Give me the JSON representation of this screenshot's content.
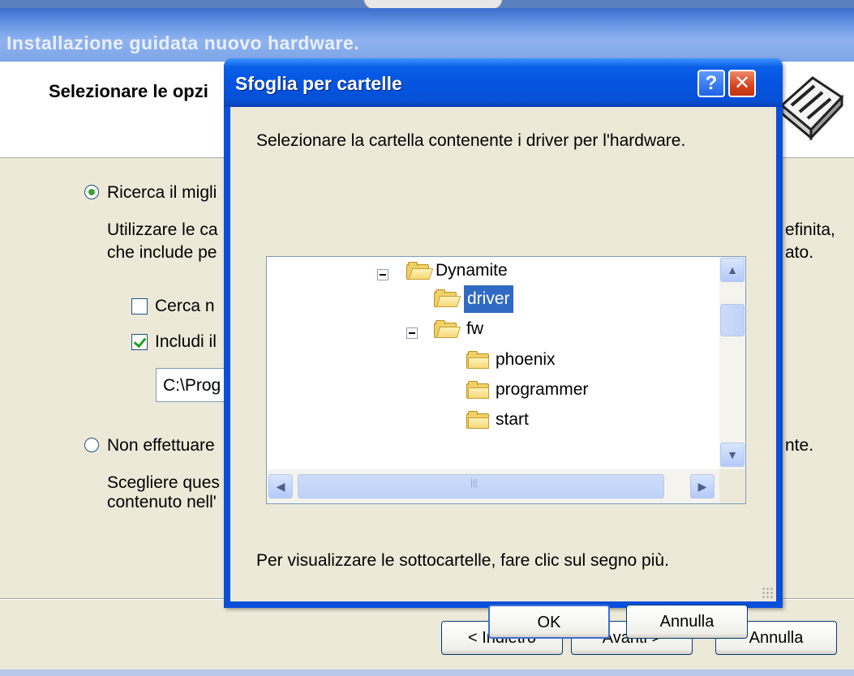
{
  "wizard": {
    "title": "Installazione guidata nuovo hardware.",
    "header_title": "Selezionare le opzi",
    "option1": {
      "label": "Ricerca il migli",
      "desc_line1": "Utilizzare le ca",
      "desc_line2": "che include pe",
      "desc_right1": "efinita,",
      "desc_right2": "ato."
    },
    "check_removable": {
      "label": "Cerca n",
      "checked": false
    },
    "check_include": {
      "label": "Includi il",
      "checked": true
    },
    "path_value": "C:\\Prog",
    "option2": {
      "label": "Non effettuare",
      "right_text": "nte.",
      "desc_line1": "Scegliere ques",
      "desc_line2": "contenuto nell'"
    },
    "buttons": {
      "back": "< Indietro",
      "next": "Avanti >",
      "cancel": "Annulla"
    }
  },
  "dialog": {
    "title": "Sfoglia per cartelle",
    "help_glyph": "?",
    "close_glyph": "✕",
    "description": "Selezionare la cartella contenente i driver per l'hardware.",
    "tree": [
      {
        "label": "Dynamite",
        "expanded": true,
        "selected": false
      },
      {
        "label": "driver",
        "expanded": false,
        "selected": true
      },
      {
        "label": "fw",
        "expanded": true,
        "selected": false
      },
      {
        "label": "phoenix",
        "expanded": false,
        "selected": false
      },
      {
        "label": "programmer",
        "expanded": false,
        "selected": false
      },
      {
        "label": "start",
        "expanded": false,
        "selected": false
      }
    ],
    "hint": "Per visualizzare le sottocartelle, fare clic sul segno più.",
    "ok_label": "OK",
    "cancel_label": "Annulla",
    "scroll_up_glyph": "▲",
    "scroll_down_glyph": "▼",
    "scroll_left_glyph": "◀",
    "scroll_right_glyph": "▶",
    "thumb_grip": "|||"
  },
  "icons": {
    "hardware": "hardware-card-icon",
    "folder": "folder-icon",
    "folder_open": "folder-open-icon"
  },
  "colors": {
    "xp_face": "#ece9d8",
    "title_blue": "#0454e0",
    "selection": "#316ac5",
    "close_red": "#d6421d",
    "radio_green": "#3aa13a"
  }
}
